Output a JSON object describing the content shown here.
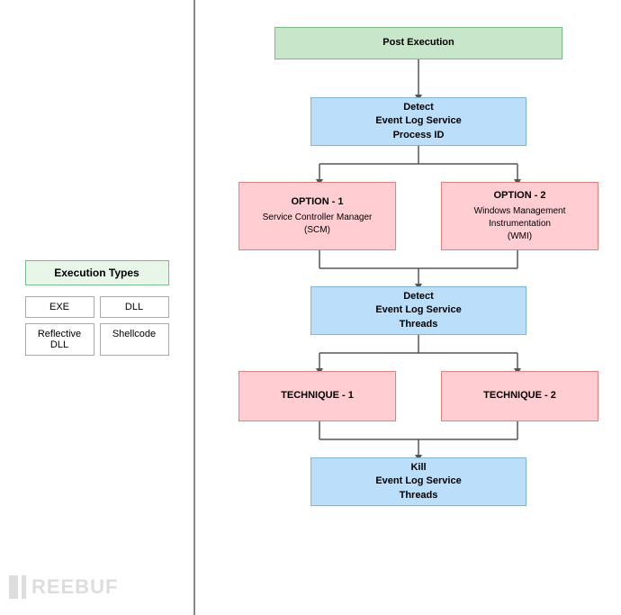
{
  "left": {
    "execution_types_label": "Execution Types",
    "exec_items": [
      "EXE",
      "DLL",
      "Reflective DLL",
      "Shellcode"
    ]
  },
  "right": {
    "post_execution": "Post Execution",
    "detect_pid": "Detect\nEvent Log Service\nProcess ID",
    "option1_title": "OPTION - 1",
    "option1_desc": "Service Controller Manager\n(SCM)",
    "option2_title": "OPTION - 2",
    "option2_desc": "Windows Management Instrumentation\n(WMI)",
    "detect_threads": "Detect\nEvent Log Service\nThreads",
    "technique1": "TECHNIQUE - 1",
    "technique2": "TECHNIQUE - 2",
    "kill_threads": "Kill\nEvent Log Service\nThreads"
  },
  "watermark": "FREEBUF"
}
